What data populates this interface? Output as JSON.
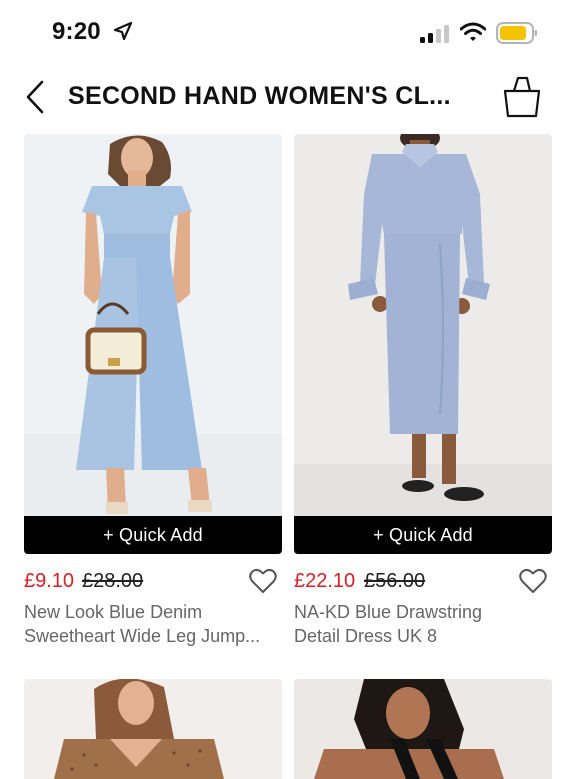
{
  "status": {
    "time": "9:20",
    "battery_color": "#f5c400"
  },
  "nav": {
    "title": "SECOND HAND WOMEN'S CL..."
  },
  "products": [
    {
      "quick_add": "+ Quick Add",
      "price_now": "£9.10",
      "price_was": "£28.00",
      "title_line1": "New Look Blue Denim",
      "title_line2": "Sweetheart Wide Leg Jump..."
    },
    {
      "quick_add": "+ Quick Add",
      "price_now": "£22.10",
      "price_was": "£56.00",
      "title_line1": "NA-KD Blue Drawstring",
      "title_line2": "Detail Dress UK 8"
    }
  ],
  "colors": {
    "sale_price": "#d61f26",
    "quick_add_bg": "#000000",
    "image_bg_1": "#eef2f4",
    "image_bg_2": "#ecebea"
  },
  "icons": [
    "location-arrow-icon",
    "signal-icon",
    "wifi-icon",
    "battery-icon",
    "back-chevron-icon",
    "shopping-bag-icon",
    "heart-icon"
  ]
}
